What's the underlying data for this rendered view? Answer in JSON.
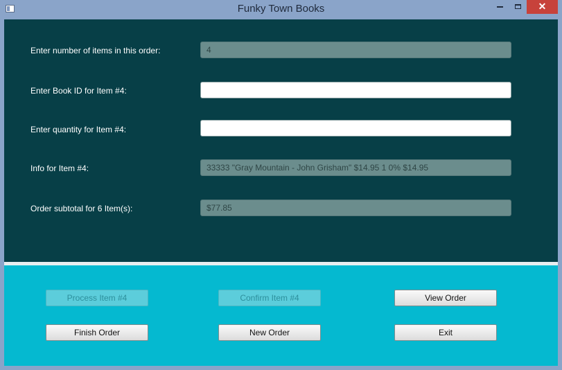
{
  "window": {
    "title": "Funky Town Books",
    "close_glyph": "✕"
  },
  "form": {
    "num_items": {
      "label": "Enter number of items in this order:",
      "value": "4"
    },
    "book_id": {
      "label": "Enter Book ID for Item #4:",
      "value": ""
    },
    "quantity": {
      "label": "Enter quantity for Item #4:",
      "value": ""
    },
    "info": {
      "label": "Info for Item #4:",
      "value": "33333 \"Gray Mountain - John Grisham\" $14.95 1 0% $14.95"
    },
    "subtotal": {
      "label": "Order subtotal for 6 Item(s):",
      "value": "$77.85"
    }
  },
  "buttons": {
    "process": "Process Item #4",
    "confirm": "Confirm Item #4",
    "view": "View Order",
    "finish": "Finish Order",
    "new_order": "New Order",
    "exit": "Exit"
  },
  "colors": {
    "form_background": "#073f47",
    "button_panel_background": "#05b9d0",
    "readonly_field": "#6b8d8d",
    "close_button": "#c7423b"
  }
}
